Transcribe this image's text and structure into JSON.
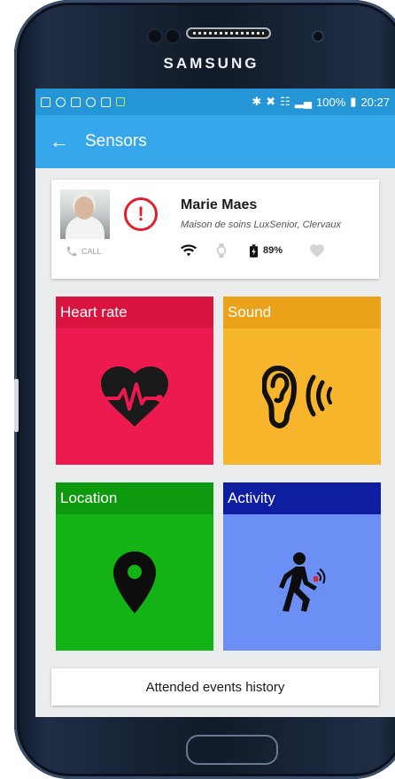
{
  "device": {
    "brand": "SAMSUNG"
  },
  "statusbar": {
    "right_text": "100%",
    "time": "20:27"
  },
  "appbar": {
    "title": "Sensors"
  },
  "patient": {
    "name": "Marie Maes",
    "location": "Maison de soins LuxSenior, Clervaux",
    "call_label": "CALL",
    "battery": "89%"
  },
  "tiles": [
    {
      "label": "Heart rate",
      "icon": "heart-rate-icon",
      "color": "#ec1a4f"
    },
    {
      "label": "Sound",
      "icon": "ear-sound-icon",
      "color": "#f7b52b"
    },
    {
      "label": "Location",
      "icon": "location-pin-icon",
      "color": "#13b315"
    },
    {
      "label": "Activity",
      "icon": "walking-person-icon",
      "color": "#6c8ff5"
    }
  ],
  "history_button": {
    "label": "Attended events history"
  },
  "colors": {
    "statusbar": "#2496d6",
    "appbar": "#35a7ea",
    "alert": "#e01f2d"
  }
}
